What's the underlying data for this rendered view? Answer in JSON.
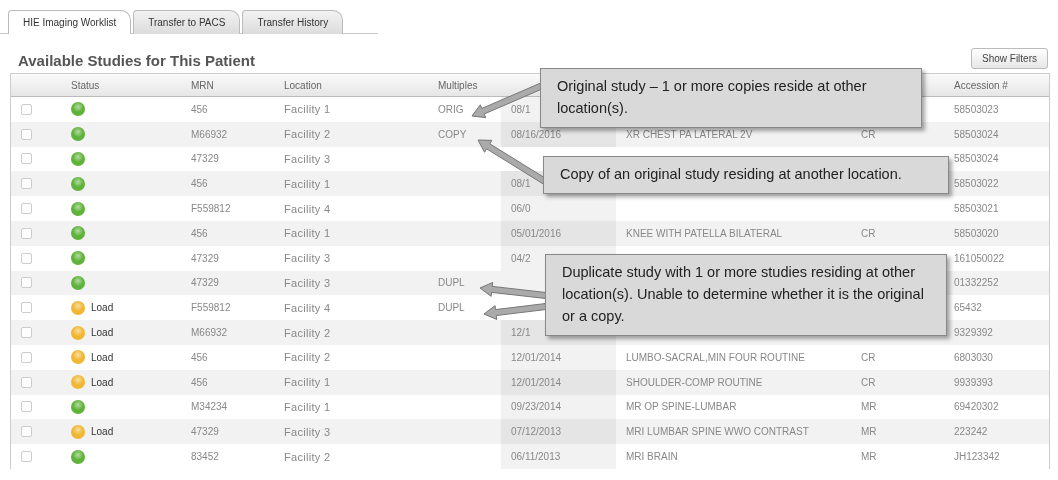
{
  "tabs": [
    {
      "label": "HIE Imaging Worklist",
      "selected": true
    },
    {
      "label": "Transfer to PACS",
      "selected": false
    },
    {
      "label": "Transfer History",
      "selected": false
    }
  ],
  "title": "Available Studies for This Patient",
  "show_filters_button": "Show Filters",
  "table": {
    "columns": [
      "",
      "Status",
      "MRN",
      "Location",
      "Multiples",
      "",
      "",
      "",
      "Accession #"
    ],
    "rows": [
      {
        "checked": false,
        "loading": false,
        "mrn": "456",
        "location": "Facility 1",
        "multiples": "ORIG",
        "date": "08/1",
        "accession": "58503023"
      },
      {
        "checked": false,
        "loading": false,
        "mrn": "M66932",
        "location": "Facility 2",
        "multiples": "COPY",
        "date": "08/16/2016",
        "description": "XR CHEST PA LATERAL 2V",
        "modality": "CR",
        "accession": "58503024"
      },
      {
        "checked": false,
        "loading": false,
        "mrn": "47329",
        "location": "Facility 3",
        "accession": "58503024"
      },
      {
        "checked": false,
        "loading": false,
        "mrn": "456",
        "location": "Facility 1",
        "date": "08/1",
        "accession": "58503022"
      },
      {
        "checked": false,
        "loading": false,
        "mrn": "F559812",
        "location": "Facility 4",
        "date": "06/0",
        "accession": "58503021"
      },
      {
        "checked": false,
        "loading": false,
        "mrn": "456",
        "location": "Facility 1",
        "date": "05/01/2016",
        "description": "KNEE WITH PATELLA BILATERAL",
        "modality": "CR",
        "accession": "58503020"
      },
      {
        "checked": false,
        "loading": false,
        "mrn": "47329",
        "location": "Facility 3",
        "date": "04/2",
        "accession": "161050022"
      },
      {
        "checked": false,
        "loading": false,
        "mrn": "47329",
        "location": "Facility 3",
        "multiples": "DUPL",
        "accession": "01332252"
      },
      {
        "checked": false,
        "loading": true,
        "status_label": "Load",
        "mrn": "F559812",
        "location": "Facility 4",
        "multiples": "DUPL",
        "accession": "65432"
      },
      {
        "checked": false,
        "loading": true,
        "status_label": "Load",
        "mrn": "M66932",
        "location": "Facility 2",
        "date": "12/1",
        "accession": "9329392"
      },
      {
        "checked": false,
        "loading": true,
        "status_label": "Load",
        "mrn": "456",
        "location": "Facility 2",
        "date": "12/01/2014",
        "description": "LUMBO-SACRAL,MIN FOUR ROUTINE",
        "modality": "CR",
        "accession": "6803030"
      },
      {
        "checked": false,
        "loading": true,
        "status_label": "Load",
        "mrn": "456",
        "location": "Facility 1",
        "date": "12/01/2014",
        "description": "SHOULDER-COMP ROUTINE",
        "modality": "CR",
        "accession": "9939393"
      },
      {
        "checked": false,
        "loading": false,
        "mrn": "M34234",
        "location": "Facility 1",
        "date": "09/23/2014",
        "description": "MR OP SPINE-LUMBAR",
        "modality": "MR",
        "accession": "69420302"
      },
      {
        "checked": false,
        "loading": true,
        "status_label": "Load",
        "mrn": "47329",
        "location": "Facility 3",
        "date": "07/12/2013",
        "description": "MRI LUMBAR SPINE WWO CONTRAST",
        "modality": "MR",
        "accession": "223242"
      },
      {
        "checked": false,
        "loading": false,
        "mrn": "83452",
        "location": "Facility 2",
        "date": "06/11/2013",
        "description": "MRI BRAIN",
        "modality": "MR",
        "accession": "JH123342"
      }
    ]
  },
  "callouts": [
    {
      "text": "Original study – 1 or more copies reside at other location(s)."
    },
    {
      "text": "Copy of an original study residing at another location."
    },
    {
      "text": "Duplicate study with 1 or more studies residing at other location(s). Unable to determine whether it is the original or a copy."
    }
  ]
}
